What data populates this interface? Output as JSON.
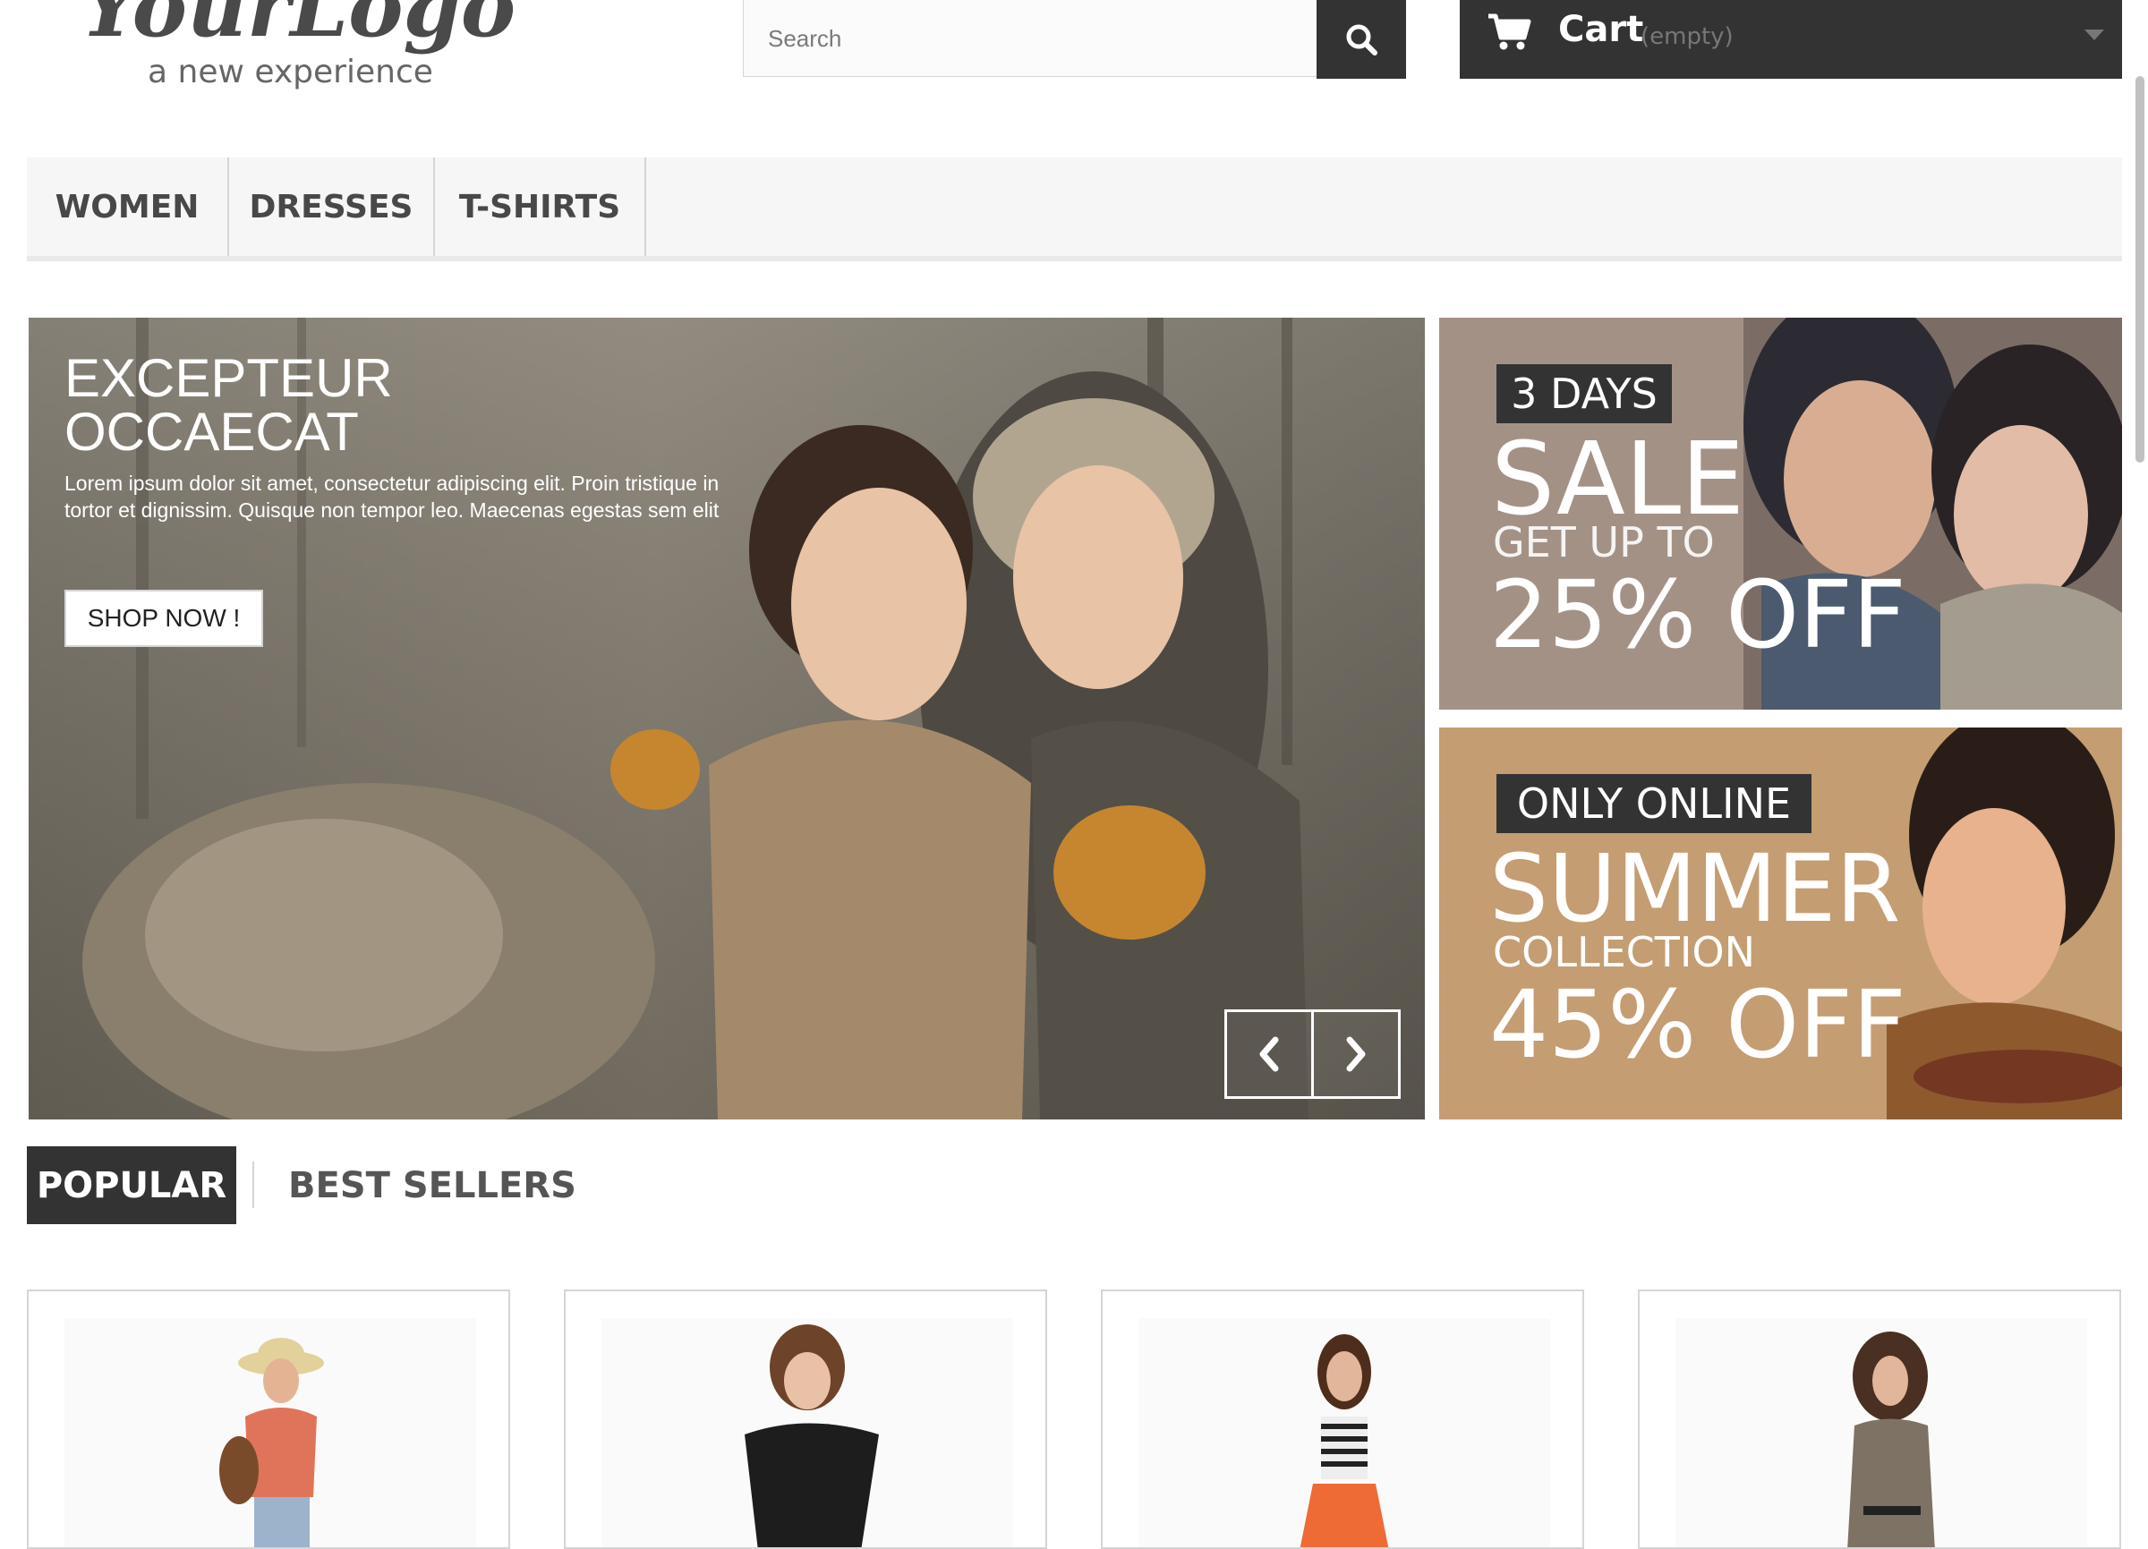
{
  "header": {
    "logo": {
      "main_text": "YourLogo",
      "tagline": "a new experience"
    },
    "search": {
      "placeholder": "Search",
      "value": ""
    },
    "cart": {
      "label": "Cart",
      "status": "(empty)"
    }
  },
  "nav": {
    "items": [
      {
        "label": "WOMEN"
      },
      {
        "label": "DRESSES"
      },
      {
        "label": "T-SHIRTS"
      }
    ]
  },
  "hero": {
    "title_line1": "EXCEPTEUR",
    "title_line2": "OCCAECAT",
    "text": "Lorem ipsum dolor sit amet, consectetur adipiscing elit. Proin tristique in tortor et dignissim. Quisque non tempor leo. Maecenas egestas sem elit",
    "button_label": "SHOP NOW !"
  },
  "promos": [
    {
      "tag": "3 DAYS",
      "headline": "SALE",
      "subline": "GET UP TO",
      "offer": "25% OFF"
    },
    {
      "tag": "ONLY ONLINE",
      "headline": "SUMMER",
      "subline": "COLLECTION",
      "offer": "45% OFF"
    }
  ],
  "tabs": [
    {
      "label": "POPULAR"
    },
    {
      "label": "BEST SELLERS"
    }
  ],
  "colors": {
    "dark": "#333333",
    "nav_bg": "#f6f6f6",
    "border": "#d6d4d4"
  },
  "icons": {
    "search": "search-icon",
    "cart": "cart-icon",
    "caret": "chevron-down-icon",
    "prev": "chevron-left-icon",
    "next": "chevron-right-icon"
  }
}
